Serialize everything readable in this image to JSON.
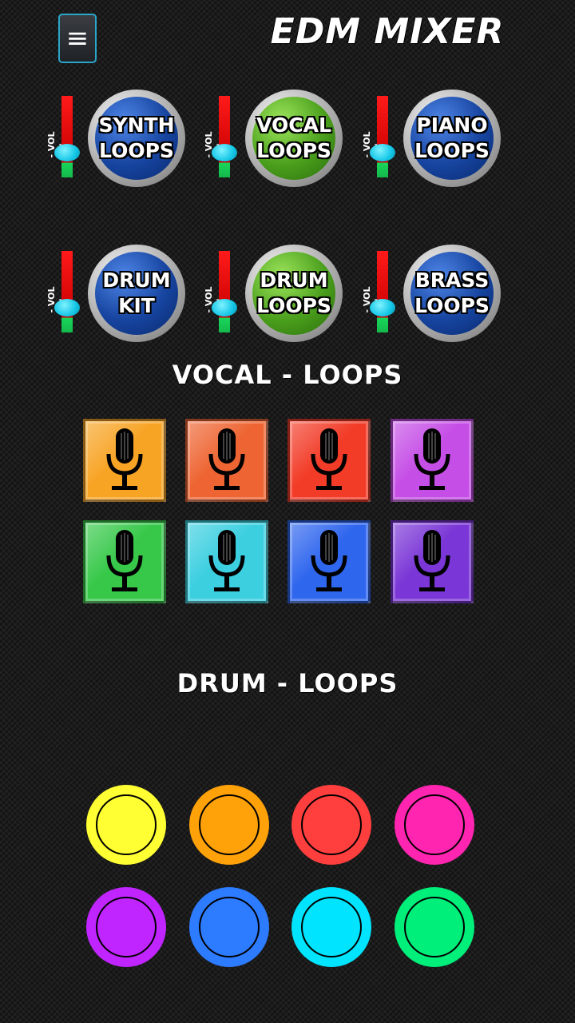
{
  "header": {
    "title": "EDM MIXER",
    "menu_icon": "≡"
  },
  "mixer": {
    "vol_label": "- VOL +",
    "channels": [
      {
        "label": "SYNTH\nLOOPS",
        "color": "blue",
        "volume": 0.3
      },
      {
        "label": "VOCAL\nLOOPS",
        "color": "green",
        "volume": 0.3
      },
      {
        "label": "PIANO\nLOOPS",
        "color": "blue",
        "volume": 0.3
      },
      {
        "label": "DRUM\nKIT",
        "color": "blue",
        "volume": 0.3
      },
      {
        "label": "DRUM\nLOOPS",
        "color": "green",
        "volume": 0.3
      },
      {
        "label": "BRASS\nLOOPS",
        "color": "blue",
        "volume": 0.3
      }
    ]
  },
  "vocal_section": {
    "title": "VOCAL - LOOPS",
    "pad_icon": "microphone-icon",
    "pads": [
      "#f7a425",
      "#ee6533",
      "#f23c28",
      "#c54ee6",
      "#37c84a",
      "#3bcfe0",
      "#2f66ee",
      "#7a36d6"
    ]
  },
  "drum_section": {
    "title": "DRUM - LOOPS",
    "pads": [
      "#ffff33",
      "#ffa20a",
      "#ff3e3e",
      "#ff25b0",
      "#c025ff",
      "#2d7bff",
      "#00e4ff",
      "#00ee7a"
    ]
  }
}
